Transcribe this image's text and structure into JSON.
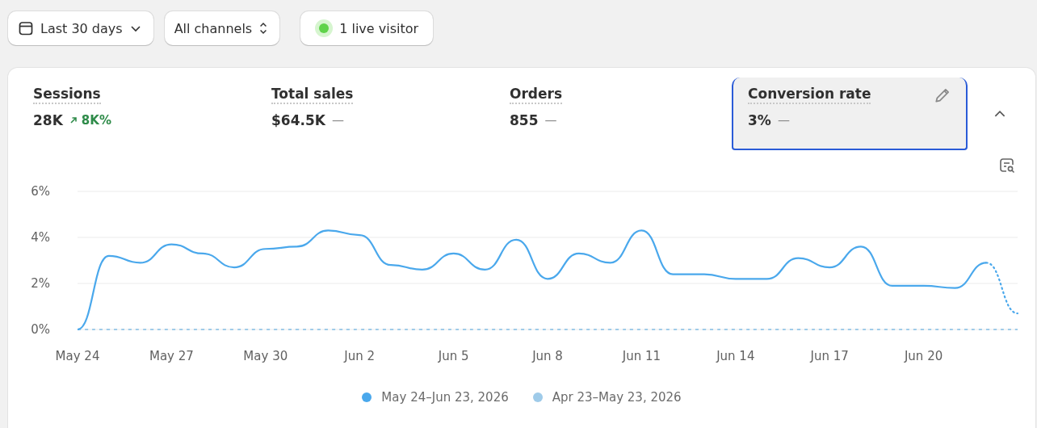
{
  "toolbar": {
    "date_range": "Last 30 days",
    "channels": "All channels",
    "live_visitors": "1 live visitor"
  },
  "metrics": [
    {
      "label": "Sessions",
      "value": "28K",
      "change": {
        "kind": "up",
        "text": "8K%"
      },
      "selected": false
    },
    {
      "label": "Total sales",
      "value": "$64.5K",
      "change": {
        "kind": "none",
        "text": "—"
      },
      "selected": false
    },
    {
      "label": "Orders",
      "value": "855",
      "change": {
        "kind": "none",
        "text": "—"
      },
      "selected": false
    },
    {
      "label": "Conversion rate",
      "value": "3%",
      "change": {
        "kind": "none",
        "text": "—"
      },
      "selected": true
    }
  ],
  "chart": {
    "partial_last_day": true,
    "chart_data": {
      "type": "line",
      "categories": [
        "May 24",
        null,
        null,
        "May 27",
        null,
        null,
        "May 30",
        null,
        null,
        "Jun 2",
        null,
        null,
        "Jun 5",
        null,
        null,
        "Jun 8",
        null,
        null,
        "Jun 11",
        null,
        null,
        "Jun 14",
        null,
        null,
        "Jun 17",
        null,
        null,
        "Jun 20",
        null,
        null,
        null
      ],
      "ylim": [
        0,
        6
      ],
      "yticks": [
        {
          "value": 0,
          "label": "0%"
        },
        {
          "value": 2,
          "label": "2%"
        },
        {
          "value": 4,
          "label": "4%"
        },
        {
          "value": 6,
          "label": "6%"
        }
      ],
      "series": [
        {
          "name": "May 24–Jun 23, 2026",
          "color": "#4aa8ec",
          "line_style": "solid",
          "values": [
            0,
            3.2,
            2.9,
            3.7,
            3.3,
            2.7,
            3.5,
            3.6,
            4.3,
            4.1,
            2.8,
            2.6,
            3.3,
            2.6,
            3.9,
            2.2,
            3.3,
            2.9,
            4.3,
            2.4,
            2.4,
            2.2,
            2.2,
            3.1,
            2.7,
            3.6,
            1.9,
            1.9,
            1.8,
            2.9,
            0.7
          ]
        },
        {
          "name": "Apr 23–May 23, 2026",
          "color": "#9fcbe9",
          "line_style": "dashed",
          "values": [
            0,
            0,
            0,
            0,
            0,
            0,
            0,
            0,
            0,
            0,
            0,
            0,
            0,
            0,
            0,
            0,
            0,
            0,
            0,
            0,
            0,
            0,
            0,
            0,
            0,
            0,
            0,
            0,
            0,
            0,
            0
          ]
        }
      ]
    }
  }
}
